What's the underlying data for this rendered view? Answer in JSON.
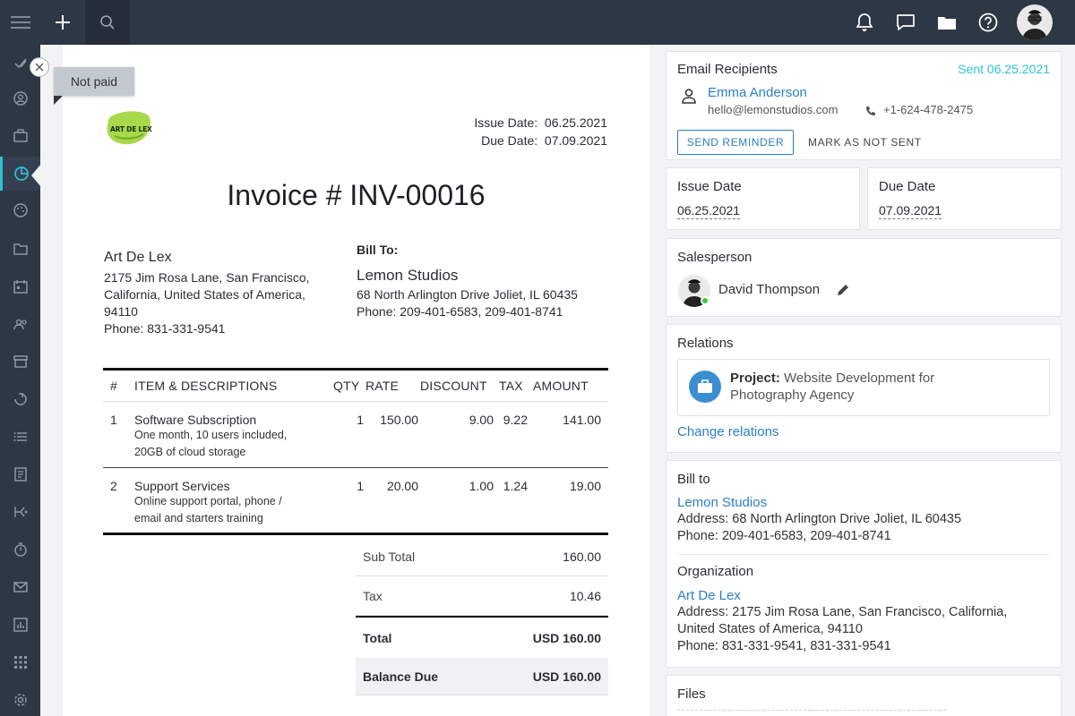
{
  "topbar": {
    "icons": [
      "menu-icon",
      "plus-icon",
      "search-icon",
      "bell-icon",
      "chat-icon",
      "folder-icon",
      "help-icon",
      "user-avatar"
    ]
  },
  "sidebar": {
    "items": [
      "check-icon",
      "contact-icon",
      "briefcase-icon",
      "pie-chart-icon",
      "palette-icon",
      "folder-icon",
      "calendar-icon",
      "users-icon",
      "archive-icon",
      "megaphone-icon",
      "list-icon",
      "document-icon",
      "flow-icon",
      "timer-icon",
      "mail-icon",
      "report-icon",
      "apps-icon",
      "settings-icon"
    ],
    "active_index": 3
  },
  "tooltip": {
    "text": "Not paid"
  },
  "invoice": {
    "logo_text": "ART DE LEX",
    "issue_date_label": "Issue Date:",
    "issue_date": "06.25.2021",
    "due_date_label": "Due Date:",
    "due_date": "07.09.2021",
    "title": "Invoice # INV-00016",
    "from": {
      "name": "Art De Lex",
      "address1": "2175 Jim Rosa Lane, San Francisco,",
      "address2": "California, United States of America,",
      "address3": "94110",
      "phone": "Phone: 831-331-9541"
    },
    "bill_to": {
      "label": "Bill To:",
      "name": "Lemon Studios",
      "address": "68 North Arlington Drive Joliet, IL 60435",
      "phone": "Phone: 209-401-6583, 209-401-8741"
    },
    "columns": [
      "#",
      "ITEM & DESCRIPTIONS",
      "QTY",
      "RATE",
      "DISCOUNT",
      "TAX",
      "AMOUNT"
    ],
    "items": [
      {
        "num": "1",
        "name": "Software Subscription",
        "desc1": "One month, 10 users included,",
        "desc2": "20GB of cloud storage",
        "qty": "1",
        "rate": "150.00",
        "discount": "9.00",
        "tax": "9.22",
        "amount": "141.00"
      },
      {
        "num": "2",
        "name": "Support Services",
        "desc1": "Online support portal, phone /",
        "desc2": "email and starters training",
        "qty": "1",
        "rate": "20.00",
        "discount": "1.00",
        "tax": "1.24",
        "amount": "19.00"
      }
    ],
    "totals": {
      "subtotal_label": "Sub Total",
      "subtotal": "160.00",
      "tax_label": "Tax",
      "tax": "10.46",
      "total_label": "Total",
      "total": "USD 160.00",
      "balance_label": "Balance Due",
      "balance": "USD 160.00"
    }
  },
  "email": {
    "title": "Email Recipients",
    "sent": "Sent 06.25.2021",
    "name": "Emma Anderson",
    "email": "hello@lemonstudios.com",
    "phone": "+1-624-478-2475",
    "send_reminder": "SEND REMINDER",
    "mark_not_sent": "MARK AS NOT SENT"
  },
  "issue": {
    "title": "Issue Date",
    "value": "06.25.2021"
  },
  "due": {
    "title": "Due Date",
    "value": "07.09.2021"
  },
  "salesperson": {
    "title": "Salesperson",
    "name": "David Thompson"
  },
  "relations": {
    "title": "Relations",
    "project_label": "Project:",
    "project_line1": "Website Development for",
    "project_line2": "Photography Agency",
    "change": "Change relations"
  },
  "billto_card": {
    "title": "Bill to",
    "name": "Lemon Studios",
    "address": "Address: 68 North Arlington Drive Joliet, IL 60435",
    "phone": "Phone: 209-401-6583, 209-401-8741",
    "org_title": "Organization",
    "org_name": "Art De Lex",
    "org_address1": "Address: 2175 Jim Rosa Lane, San Francisco, California,",
    "org_address2": "United States of America, 94110",
    "org_phone": "Phone: 831-331-9541, 831-331-9541"
  },
  "files": {
    "title": "Files"
  },
  "colors": {
    "accent": "#2fc1d5",
    "link": "#2b7fc3",
    "sidebar": "#2e3744",
    "online": "#3ec43e"
  }
}
